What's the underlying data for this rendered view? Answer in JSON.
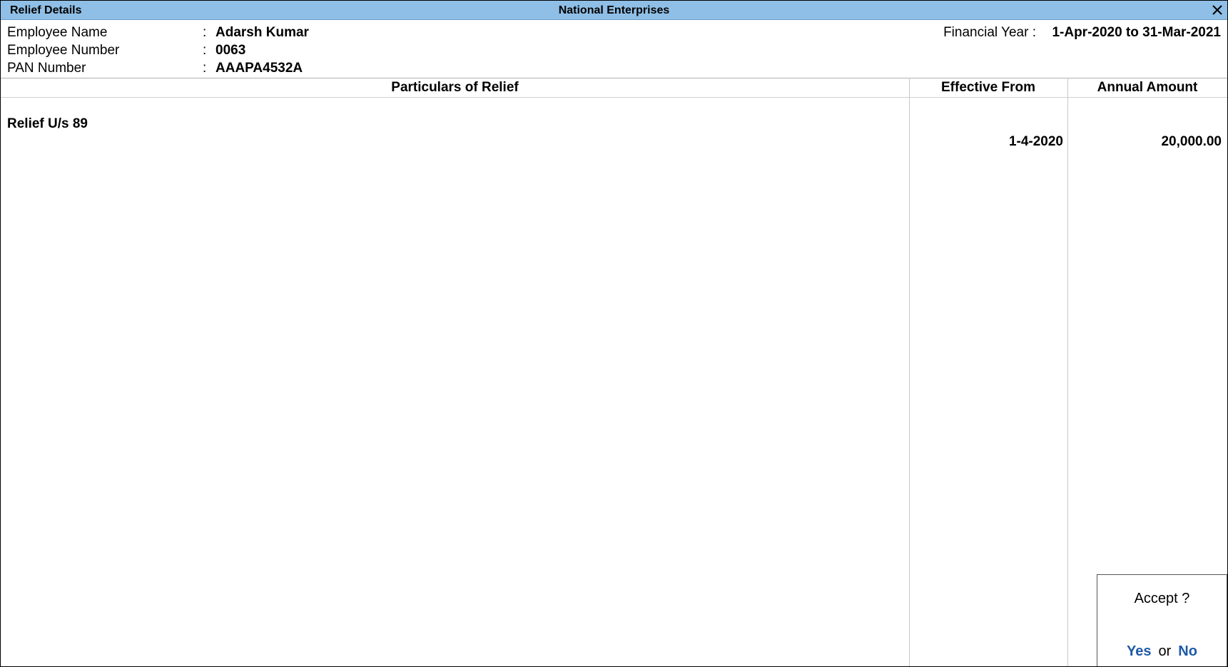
{
  "window": {
    "title": "Relief Details",
    "company": "National Enterprises"
  },
  "employee": {
    "name_label": "Employee Name",
    "name_value": "Adarsh Kumar",
    "number_label": "Employee Number",
    "number_value": "0063",
    "pan_label": "PAN Number",
    "pan_value": "AAAPA4532A",
    "separator": ":"
  },
  "financial_year": {
    "label": "Financial Year :",
    "value": "1-Apr-2020 to 31-Mar-2021"
  },
  "table": {
    "columns": [
      "Particulars of Relief",
      "Effective From",
      "Annual Amount"
    ],
    "rows": [
      {
        "particular": "Relief U/s 89",
        "effective_from": "1-4-2020",
        "annual_amount": "20,000.00"
      }
    ]
  },
  "accept_dialog": {
    "title": "Accept ?",
    "yes": "Yes",
    "or": "or",
    "no": "No"
  },
  "colors": {
    "titlebar": "#8fbfe6",
    "choice_accent": "#1e5aa8"
  },
  "icons": {
    "close": "close-icon"
  }
}
